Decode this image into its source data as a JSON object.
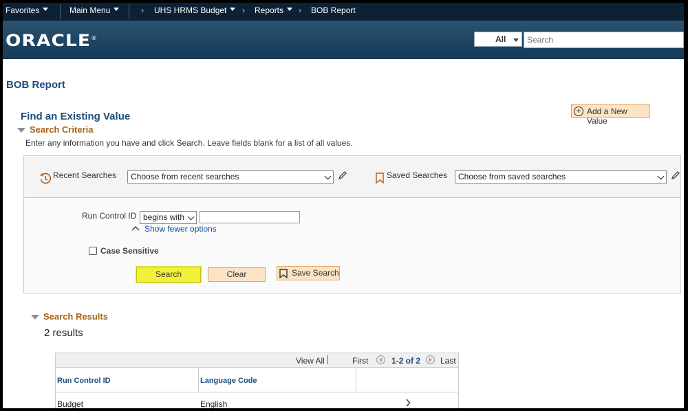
{
  "nav": {
    "favorites": "Favorites",
    "main_menu": "Main Menu",
    "breadcrumbs": [
      "UHS HRMS Budget",
      "Reports",
      "BOB Report"
    ]
  },
  "branding": {
    "logo": "ORACLE",
    "search_category": "All",
    "search_placeholder": "Search"
  },
  "page": {
    "title": "BOB Report",
    "find_title": "Find an Existing Value",
    "add_new": "Add a New Value"
  },
  "criteria": {
    "heading": "Search Criteria",
    "instructions": "Enter any information you have and click Search. Leave fields blank for a list of all values.",
    "recent_label": "Recent Searches",
    "recent_value": "Choose from recent searches",
    "saved_label": "Saved Searches",
    "saved_value": "Choose from saved searches",
    "run_control_label": "Run Control ID",
    "operator_value": "begins with",
    "run_control_value": "",
    "fewer_options": "Show fewer options",
    "case_sensitive": "Case Sensitive",
    "search_btn": "Search",
    "clear_btn": "Clear",
    "save_search_btn": "Save Search"
  },
  "results": {
    "heading": "Search Results",
    "count": "2 results",
    "view_all": "View All",
    "first": "First",
    "range": "1-2 of 2",
    "last": "Last",
    "columns": [
      "Run Control ID",
      "Language Code"
    ],
    "rows": [
      {
        "run_control_id": "Budget",
        "language_code": "English"
      }
    ]
  },
  "colors": {
    "nav_bg": "#0c2234",
    "brand_bg": "#1f4565",
    "title_blue": "#1e4b7a",
    "section_orange": "#a5641b",
    "search_highlight": "#f1f13c",
    "button_peach": "#fce3c3"
  }
}
